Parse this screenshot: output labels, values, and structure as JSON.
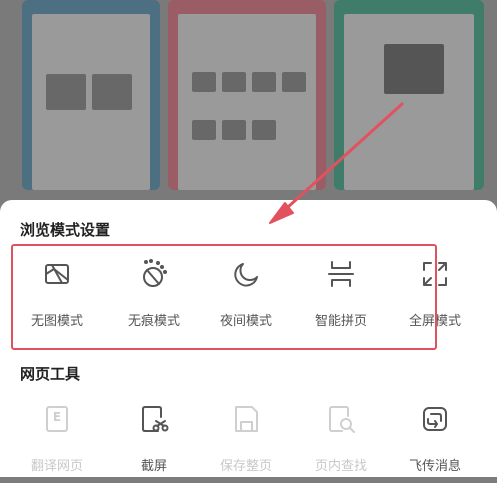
{
  "browsing_mode": {
    "title": "浏览模式设置",
    "items": [
      {
        "label": "无图模式",
        "icon": "no-image-icon"
      },
      {
        "label": "无痕模式",
        "icon": "incognito-icon"
      },
      {
        "label": "夜间模式",
        "icon": "moon-icon"
      },
      {
        "label": "智能拼页",
        "icon": "page-join-icon"
      },
      {
        "label": "全屏模式",
        "icon": "fullscreen-icon"
      }
    ]
  },
  "web_tools": {
    "title": "网页工具",
    "items": [
      {
        "label": "翻译网页",
        "icon": "translate-icon",
        "enabled": false,
        "glyph": "E"
      },
      {
        "label": "截屏",
        "icon": "screenshot-icon",
        "enabled": true
      },
      {
        "label": "保存整页",
        "icon": "save-page-icon",
        "enabled": false
      },
      {
        "label": "页内查找",
        "icon": "find-in-page-icon",
        "enabled": false
      },
      {
        "label": "飞传消息",
        "icon": "send-message-icon",
        "enabled": true
      }
    ]
  },
  "colors": {
    "highlight": "#e2525e",
    "arrow": "#e2525e"
  }
}
